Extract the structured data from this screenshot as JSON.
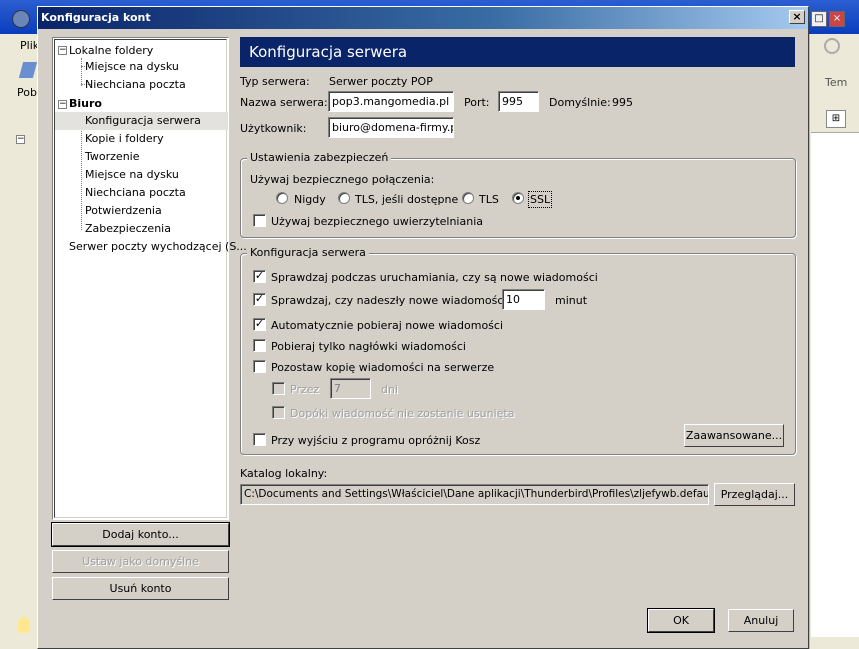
{
  "dialog": {
    "title": "Konfiguracja kont",
    "close_label": "×"
  },
  "tree": {
    "items": [
      {
        "label": "Lokalne foldery"
      },
      {
        "label": "Miejsce na dysku"
      },
      {
        "label": "Niechciana poczta"
      },
      {
        "label": "Biuro"
      },
      {
        "label": "Konfiguracja serwera"
      },
      {
        "label": "Kopie i foldery"
      },
      {
        "label": "Tworzenie"
      },
      {
        "label": "Miejsce na dysku"
      },
      {
        "label": "Niechciana poczta"
      },
      {
        "label": "Potwierdzenia"
      },
      {
        "label": "Zabezpieczenia"
      },
      {
        "label": "Serwer poczty wychodzącej (S..."
      }
    ],
    "selected": "Konfiguracja serwera"
  },
  "left_buttons": {
    "add": "Dodaj konto...",
    "default": "Ustaw jako domyślne",
    "remove": "Usuń konto"
  },
  "panel": {
    "header": "Konfiguracja serwera",
    "server_type_label": "Typ serwera:",
    "server_type_value": "Serwer poczty POP",
    "server_name_label": "Nazwa serwera:",
    "server_name_value": "pop3.mangomedia.pl",
    "port_label": "Port:",
    "port_value": "995",
    "default_label": "Domyślnie:",
    "default_value": "995",
    "user_label": "Użytkownik:",
    "user_value": "biuro@domena-firmy.pl"
  },
  "security": {
    "group_label": "Ustawienia zabezpieczeń",
    "use_secure_label": "Używaj bezpiecznego połączenia:",
    "options": [
      "Nigdy",
      "TLS, jeśli dostępne",
      "TLS",
      "SSL"
    ],
    "selected": "SSL",
    "secure_auth_label": "Używaj bezpiecznego uwierzytelniania",
    "secure_auth_checked": false
  },
  "server_config": {
    "group_label": "Konfiguracja serwera",
    "check_startup": "Sprawdzaj podczas uruchamiania, czy są nowe wiadomości",
    "check_every": "Sprawdzaj, czy nadeszły nowe wiadomości co",
    "check_every_value": "10",
    "minutes": "minut",
    "auto_download": "Automatycznie pobieraj nowe wiadomości",
    "headers_only": "Pobieraj tylko nagłówki wiadomości",
    "leave_copy": "Pozostaw kopię wiadomości na serwerze",
    "for_label": "Przez",
    "for_value": "7",
    "days": "dni",
    "until_deleted": "Dopóki wiadomość nie zostanie usunięta",
    "empty_trash": "Przy wyjściu z programu opróżnij Kosz",
    "advanced": "Zaawansowane..."
  },
  "local": {
    "label": "Katalog lokalny:",
    "path": "C:\\Documents and Settings\\Właściciel\\Dane aplikacji\\Thunderbird\\Profiles\\zljefywb.default\\Mail\\p",
    "browse": "Przeglądaj..."
  },
  "footer": {
    "ok": "OK",
    "cancel": "Anuluj"
  },
  "background": {
    "menu_file": "Plik",
    "get_label": "Pob",
    "tem": "Tem"
  }
}
